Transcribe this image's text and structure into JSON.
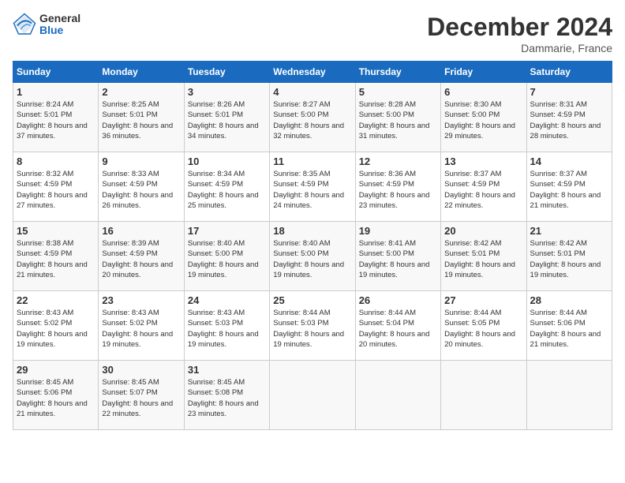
{
  "logo": {
    "general": "General",
    "blue": "Blue"
  },
  "title": "December 2024",
  "subtitle": "Dammarie, France",
  "days_of_week": [
    "Sunday",
    "Monday",
    "Tuesday",
    "Wednesday",
    "Thursday",
    "Friday",
    "Saturday"
  ],
  "weeks": [
    [
      {
        "day": 1,
        "info": "Sunrise: 8:24 AM\nSunset: 5:01 PM\nDaylight: 8 hours and 37 minutes."
      },
      {
        "day": 2,
        "info": "Sunrise: 8:25 AM\nSunset: 5:01 PM\nDaylight: 8 hours and 36 minutes."
      },
      {
        "day": 3,
        "info": "Sunrise: 8:26 AM\nSunset: 5:01 PM\nDaylight: 8 hours and 34 minutes."
      },
      {
        "day": 4,
        "info": "Sunrise: 8:27 AM\nSunset: 5:00 PM\nDaylight: 8 hours and 32 minutes."
      },
      {
        "day": 5,
        "info": "Sunrise: 8:28 AM\nSunset: 5:00 PM\nDaylight: 8 hours and 31 minutes."
      },
      {
        "day": 6,
        "info": "Sunrise: 8:30 AM\nSunset: 5:00 PM\nDaylight: 8 hours and 29 minutes."
      },
      {
        "day": 7,
        "info": "Sunrise: 8:31 AM\nSunset: 4:59 PM\nDaylight: 8 hours and 28 minutes."
      }
    ],
    [
      {
        "day": 8,
        "info": "Sunrise: 8:32 AM\nSunset: 4:59 PM\nDaylight: 8 hours and 27 minutes."
      },
      {
        "day": 9,
        "info": "Sunrise: 8:33 AM\nSunset: 4:59 PM\nDaylight: 8 hours and 26 minutes."
      },
      {
        "day": 10,
        "info": "Sunrise: 8:34 AM\nSunset: 4:59 PM\nDaylight: 8 hours and 25 minutes."
      },
      {
        "day": 11,
        "info": "Sunrise: 8:35 AM\nSunset: 4:59 PM\nDaylight: 8 hours and 24 minutes."
      },
      {
        "day": 12,
        "info": "Sunrise: 8:36 AM\nSunset: 4:59 PM\nDaylight: 8 hours and 23 minutes."
      },
      {
        "day": 13,
        "info": "Sunrise: 8:37 AM\nSunset: 4:59 PM\nDaylight: 8 hours and 22 minutes."
      },
      {
        "day": 14,
        "info": "Sunrise: 8:37 AM\nSunset: 4:59 PM\nDaylight: 8 hours and 21 minutes."
      }
    ],
    [
      {
        "day": 15,
        "info": "Sunrise: 8:38 AM\nSunset: 4:59 PM\nDaylight: 8 hours and 21 minutes."
      },
      {
        "day": 16,
        "info": "Sunrise: 8:39 AM\nSunset: 4:59 PM\nDaylight: 8 hours and 20 minutes."
      },
      {
        "day": 17,
        "info": "Sunrise: 8:40 AM\nSunset: 5:00 PM\nDaylight: 8 hours and 19 minutes."
      },
      {
        "day": 18,
        "info": "Sunrise: 8:40 AM\nSunset: 5:00 PM\nDaylight: 8 hours and 19 minutes."
      },
      {
        "day": 19,
        "info": "Sunrise: 8:41 AM\nSunset: 5:00 PM\nDaylight: 8 hours and 19 minutes."
      },
      {
        "day": 20,
        "info": "Sunrise: 8:42 AM\nSunset: 5:01 PM\nDaylight: 8 hours and 19 minutes."
      },
      {
        "day": 21,
        "info": "Sunrise: 8:42 AM\nSunset: 5:01 PM\nDaylight: 8 hours and 19 minutes."
      }
    ],
    [
      {
        "day": 22,
        "info": "Sunrise: 8:43 AM\nSunset: 5:02 PM\nDaylight: 8 hours and 19 minutes."
      },
      {
        "day": 23,
        "info": "Sunrise: 8:43 AM\nSunset: 5:02 PM\nDaylight: 8 hours and 19 minutes."
      },
      {
        "day": 24,
        "info": "Sunrise: 8:43 AM\nSunset: 5:03 PM\nDaylight: 8 hours and 19 minutes."
      },
      {
        "day": 25,
        "info": "Sunrise: 8:44 AM\nSunset: 5:03 PM\nDaylight: 8 hours and 19 minutes."
      },
      {
        "day": 26,
        "info": "Sunrise: 8:44 AM\nSunset: 5:04 PM\nDaylight: 8 hours and 20 minutes."
      },
      {
        "day": 27,
        "info": "Sunrise: 8:44 AM\nSunset: 5:05 PM\nDaylight: 8 hours and 20 minutes."
      },
      {
        "day": 28,
        "info": "Sunrise: 8:44 AM\nSunset: 5:06 PM\nDaylight: 8 hours and 21 minutes."
      }
    ],
    [
      {
        "day": 29,
        "info": "Sunrise: 8:45 AM\nSunset: 5:06 PM\nDaylight: 8 hours and 21 minutes."
      },
      {
        "day": 30,
        "info": "Sunrise: 8:45 AM\nSunset: 5:07 PM\nDaylight: 8 hours and 22 minutes."
      },
      {
        "day": 31,
        "info": "Sunrise: 8:45 AM\nSunset: 5:08 PM\nDaylight: 8 hours and 23 minutes."
      },
      null,
      null,
      null,
      null
    ]
  ]
}
